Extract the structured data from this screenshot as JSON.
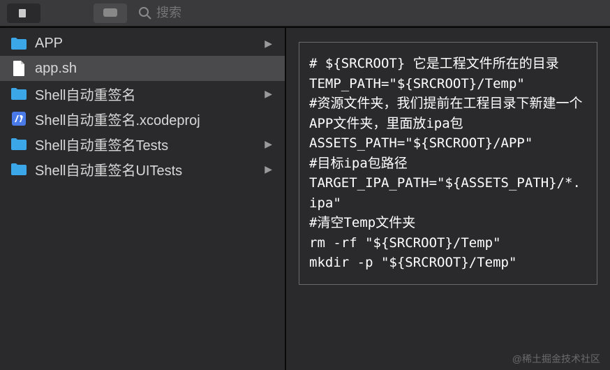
{
  "toolbar": {
    "search_placeholder": "搜索"
  },
  "sidebar": {
    "items": [
      {
        "name": "APP",
        "type": "folder",
        "expandable": true,
        "selected": false
      },
      {
        "name": "app.sh",
        "type": "file",
        "expandable": false,
        "selected": true
      },
      {
        "name": "Shell自动重签名",
        "type": "folder",
        "expandable": true,
        "selected": false
      },
      {
        "name": "Shell自动重签名.xcodeproj",
        "type": "xcodeproj",
        "expandable": false,
        "selected": false
      },
      {
        "name": "Shell自动重签名Tests",
        "type": "folder",
        "expandable": true,
        "selected": false
      },
      {
        "name": "Shell自动重签名UITests",
        "type": "folder",
        "expandable": true,
        "selected": false
      }
    ]
  },
  "preview": {
    "content": "# ${SRCROOT} 它是工程文件所在的目录\nTEMP_PATH=\"${SRCROOT}/Temp\"\n#资源文件夹，我们提前在工程目录下新建一个APP文件夹，里面放ipa包\nASSETS_PATH=\"${SRCROOT}/APP\"\n#目标ipa包路径\nTARGET_IPA_PATH=\"${ASSETS_PATH}/*.ipa\"\n#清空Temp文件夹\nrm -rf \"${SRCROOT}/Temp\"\nmkdir -p \"${SRCROOT}/Temp\""
  },
  "watermark": "@稀土掘金技术社区"
}
